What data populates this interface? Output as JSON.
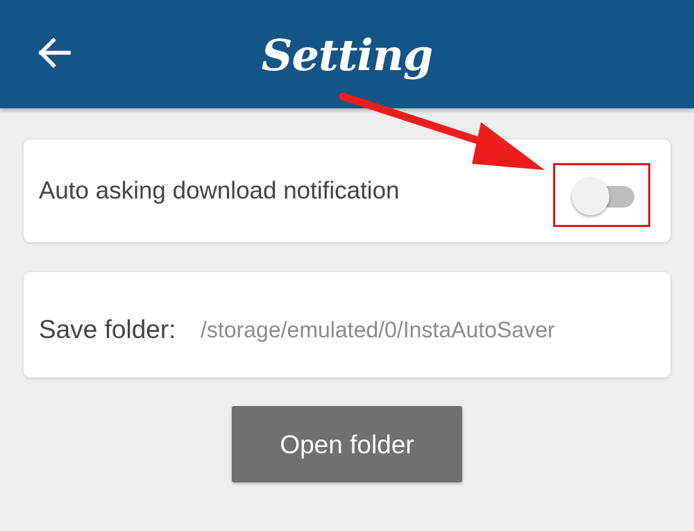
{
  "header": {
    "title": "Setting",
    "back_icon": "arrow-left-icon",
    "background_color": "#145588"
  },
  "settings": {
    "notification": {
      "label": "Auto asking download notification",
      "toggle_state": "off"
    },
    "folder": {
      "label": "Save folder:",
      "path": "/storage/emulated/0/InstaAutoSaver"
    }
  },
  "actions": {
    "open_folder_label": "Open folder",
    "button_color": "#707070"
  },
  "annotation": {
    "arrow_icon": "red-arrow-icon",
    "highlight_color": "#e01a1a"
  }
}
